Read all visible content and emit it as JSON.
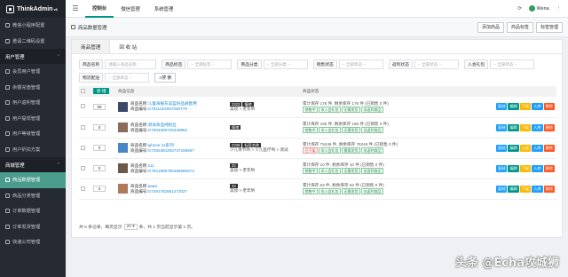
{
  "app": {
    "title": "ThinkAdmin",
    "version": "v6"
  },
  "sidebar": {
    "items_top": [
      {
        "label": "微信小程序配置"
      },
      {
        "label": "邀请二维码设置"
      }
    ],
    "group_user": {
      "label": "用户管理"
    },
    "user_items": [
      {
        "label": "会员用户管理"
      },
      {
        "label": "余额充值管理"
      },
      {
        "label": "用户返利管理"
      },
      {
        "label": "用户提现管理"
      },
      {
        "label": "用户等级管理"
      },
      {
        "label": "用户折扣方案"
      }
    ],
    "group_mall": {
      "label": "商城管理"
    },
    "mall_items": [
      {
        "label": "商品数据管理",
        "active": true
      },
      {
        "label": "商品分类管理"
      },
      {
        "label": "订单数据管理"
      },
      {
        "label": "订单发货管理"
      },
      {
        "label": "快递公司管理"
      }
    ]
  },
  "topbar": {
    "tabs": [
      {
        "label": "控制台",
        "active": true
      },
      {
        "label": "微信管理"
      },
      {
        "label": "系统管理"
      }
    ],
    "user": "Wena"
  },
  "breadcrumb": {
    "title": "商品数据管理"
  },
  "actions": {
    "add": "添加商品",
    "mark": "商品标签",
    "tag": "标签管理"
  },
  "tabs": [
    {
      "label": "商品管理"
    },
    {
      "label": "回 收 站"
    }
  ],
  "filters": {
    "row1": [
      {
        "label": "商品名称",
        "placeholder": "请输入商品名称"
      },
      {
        "label": "商品标签",
        "placeholder": "-- 全部标签 --"
      },
      {
        "label": "商品分类",
        "placeholder": "-- 全部分类 --"
      },
      {
        "label": "销售状态",
        "placeholder": "-- 全部状态 --"
      },
      {
        "label": "返利状态",
        "placeholder": "-- 全部状态 --"
      },
      {
        "label": "入会礼包",
        "placeholder": "-- 全部状态 --"
      }
    ],
    "row2": [
      {
        "label": "物流配送",
        "placeholder": "-- 全部状态 --"
      }
    ],
    "search": "搜 索"
  },
  "table": {
    "add_btn": "新 增",
    "head_info": "商品信息",
    "head_status": "商品状态",
    "name_prefix": "商品名称:",
    "code_prefix": "商品编号:",
    "rows": [
      {
        "sort": "99",
        "name": "儿童海报东美篮好品质欧用",
        "code": "G7511022057068778",
        "tags": [
          "2323",
          "情绪"
        ],
        "extra": "美妆 > 老年哟",
        "stock": "累计库存 176 件, 剩余库存 176 件 (已销售 0 件)",
        "status": [
          "销售中",
          "非入会礼包",
          "无需发货",
          "非返利商品"
        ],
        "ops": [
          "复制",
          "编辑",
          "下架",
          "入库",
          "删除"
        ],
        "thumb": "#3b4a6b"
      },
      {
        "sort": "0",
        "name": "测试商品纯粉丝",
        "code": "G7502089725349862",
        "tags": [
          "情绪"
        ],
        "extra": "",
        "stock": "累计库存 166 件, 剩余库存 166 件 (已销售 0 件)",
        "status": [
          "销售中",
          "非入会礼包",
          "无需发货",
          "非返利商品"
        ],
        "ops": [
          "复制",
          "编辑",
          "下架",
          "入库",
          "删除"
        ],
        "thumb": "#8b6b5a"
      },
      {
        "sort": "0",
        "name": "iphone 11系列",
        "code": "G7250384205737159667",
        "tags": [
          "2336",
          "标签名称"
        ],
        "extra": "少儿季节哟 > 少儿医疗哟 > 测试",
        "stock": "累计库存 75246 件, 剩余库存 75246 件 (已销售 0 件)",
        "status": [
          "已下架",
          "非入会礼包",
          "需要发货",
          "非返利商品"
        ],
        "ops": [
          "复制",
          "编辑",
          "上架",
          "入库",
          "删除"
        ],
        "thumb": "#4a86c6"
      },
      {
        "sort": "0",
        "name": "111",
        "code": "G7521805796498660673",
        "tags": [
          "33"
        ],
        "extra": "美妆 > 老年哟",
        "stock": "累计库存 10 件, 剩余库存 10 件 (已销售 0 件)",
        "status": [
          "销售中",
          "非入会礼包",
          "无需发货",
          "非返利商品"
        ],
        "ops": [
          "复制",
          "编辑",
          "下架",
          "入库",
          "删除"
        ],
        "thumb": "#6b5a4a"
      },
      {
        "sort": "0",
        "name": "aaaa",
        "code": "G7291762561273027",
        "tags": [
          "33"
        ],
        "extra": "美妆 > 老年哟",
        "stock": "累计库存 63 件, 剩余库存 63 件 (已销售 0 件)",
        "status": [
          "销售中",
          "非入会礼包",
          "无需发货",
          "非返利商品"
        ],
        "ops": [
          "复制",
          "编辑",
          "下架",
          "入库",
          "删除"
        ],
        "thumb": "#b07a5a"
      }
    ]
  },
  "pager": {
    "prefix": "共 5 条记录，每页显示",
    "size": "20",
    "suffix": "条，共 1 页当前显示第 1 页。"
  },
  "watermark": "头条 @Echa攻城狮",
  "colors": {
    "accent": "#009688",
    "sidebar": "#262b33"
  }
}
